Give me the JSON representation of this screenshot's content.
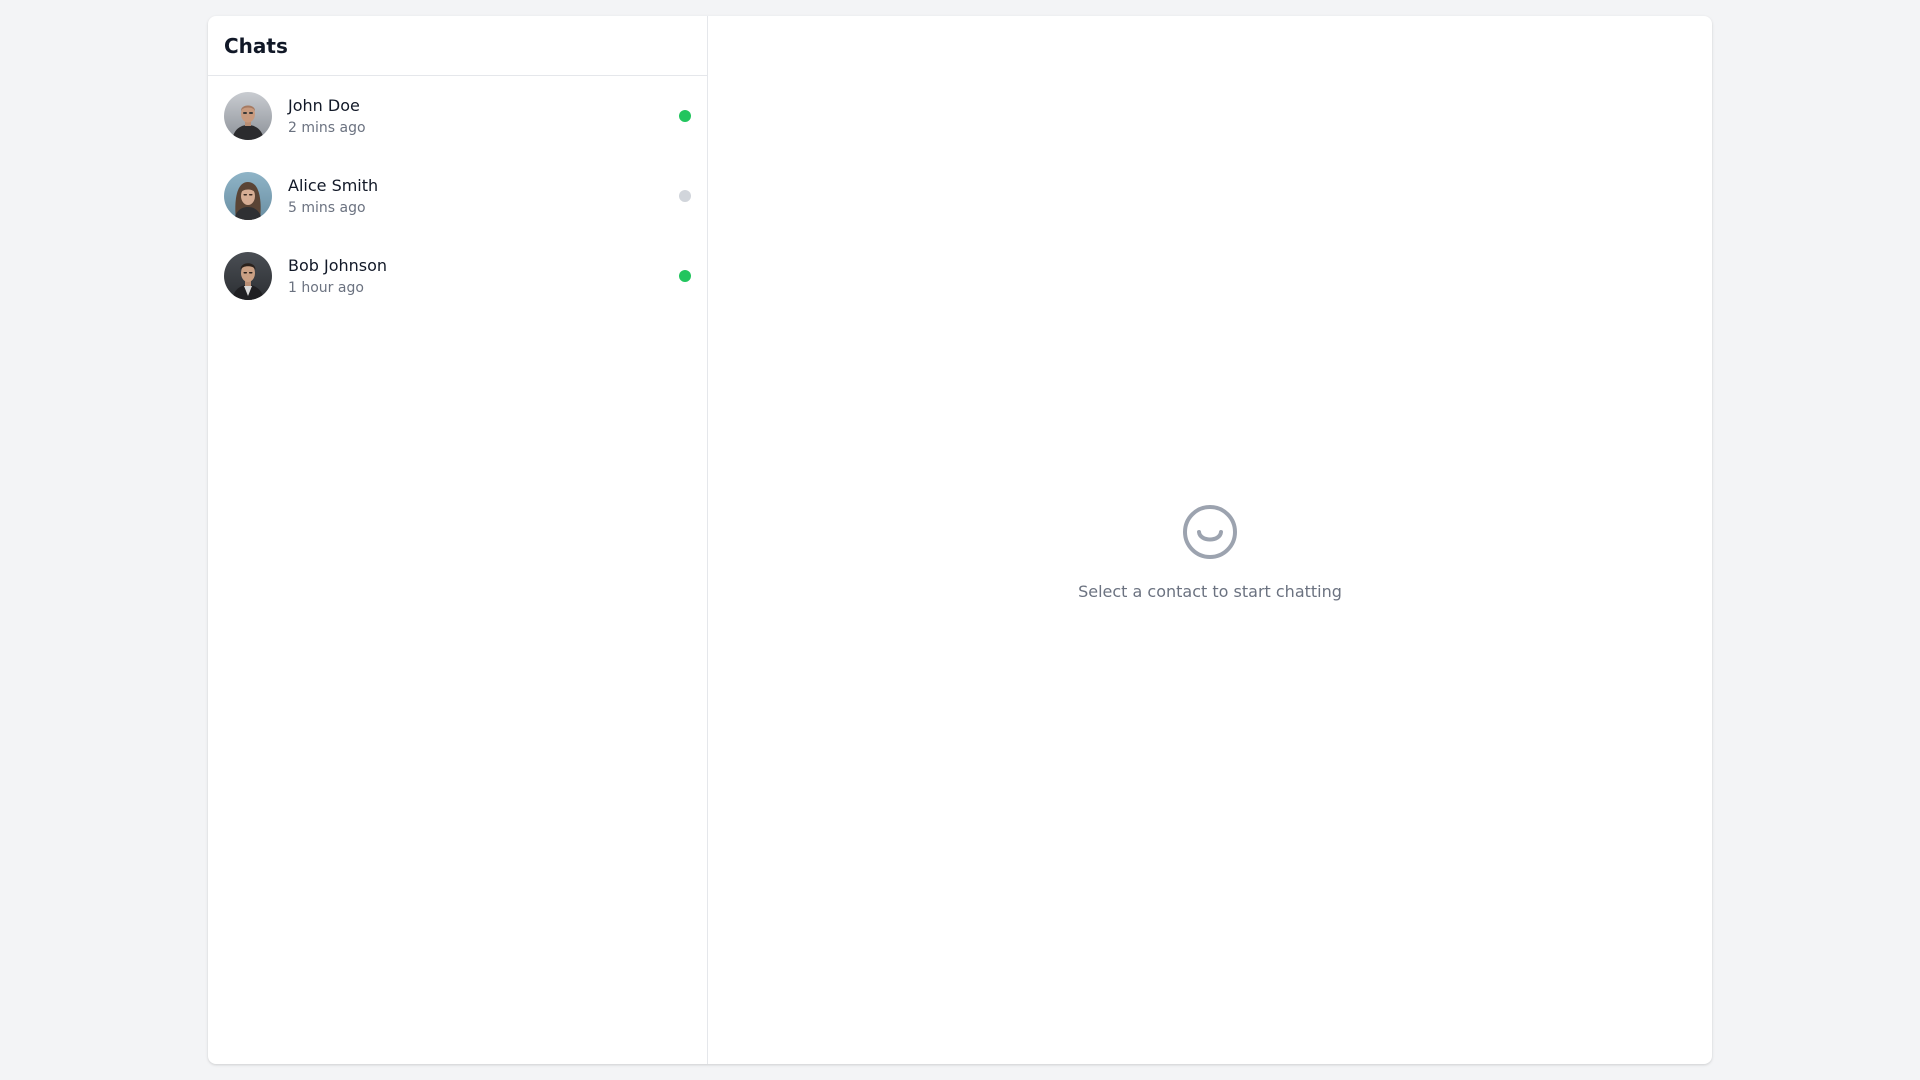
{
  "sidebar": {
    "title": "Chats",
    "contacts": [
      {
        "name": "John Doe",
        "time": "2 mins ago",
        "status": "online",
        "status_color": "#22c55e",
        "avatar_icon": "avatar-john-doe"
      },
      {
        "name": "Alice Smith",
        "time": "5 mins ago",
        "status": "offline",
        "status_color": "#d1d5db",
        "avatar_icon": "avatar-alice-smith"
      },
      {
        "name": "Bob Johnson",
        "time": "1 hour ago",
        "status": "online",
        "status_color": "#22c55e",
        "avatar_icon": "avatar-bob-johnson"
      }
    ]
  },
  "main": {
    "empty_icon": "smiley-icon",
    "empty_text": "Select a contact to start chatting"
  },
  "colors": {
    "background": "#f3f4f6",
    "online": "#22c55e",
    "offline": "#d1d5db",
    "muted_text": "#6b7280",
    "icon": "#9ca3af"
  }
}
